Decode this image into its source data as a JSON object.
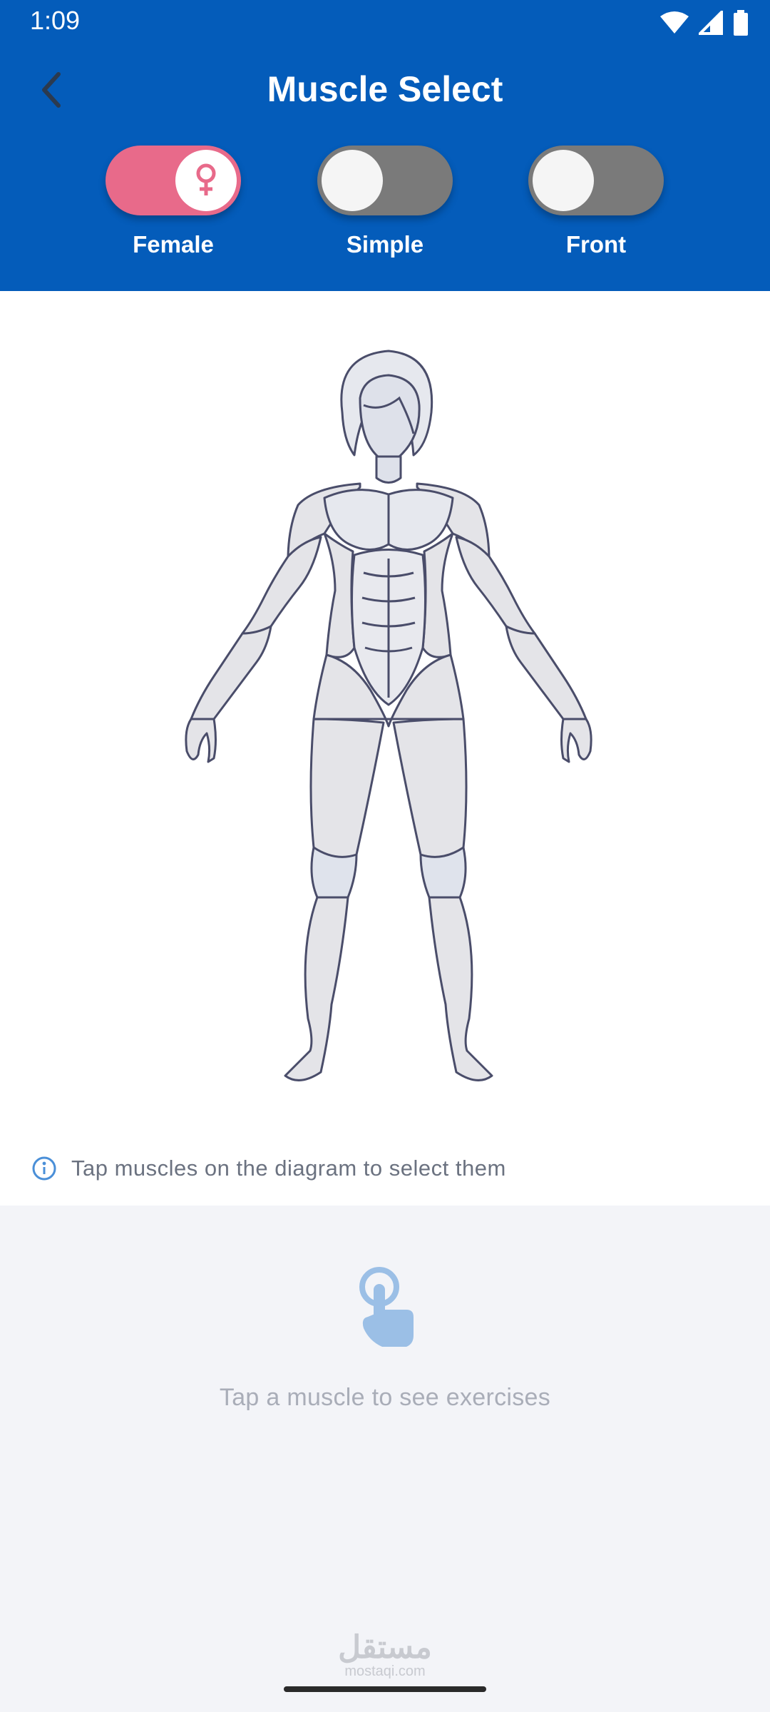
{
  "status_bar": {
    "time": "1:09",
    "icons": [
      "wifi-icon",
      "signal-icon",
      "battery-icon"
    ]
  },
  "header": {
    "title": "Muscle Select",
    "back_icon": "chevron-left-icon",
    "background": "#045cba"
  },
  "toggles": [
    {
      "label": "Female",
      "state": "on",
      "icon": "female-symbol-icon",
      "color": "#e86a8a"
    },
    {
      "label": "Simple",
      "state": "off"
    },
    {
      "label": "Front",
      "state": "off"
    }
  ],
  "diagram": {
    "hint_text": "Tap muscles on the diagram to select them",
    "hint_icon": "info-icon"
  },
  "empty_state": {
    "icon": "tap-hand-icon",
    "text": "Tap a muscle to see exercises"
  },
  "watermark": {
    "text": "مستقل",
    "sub": "mostaqi.com"
  }
}
